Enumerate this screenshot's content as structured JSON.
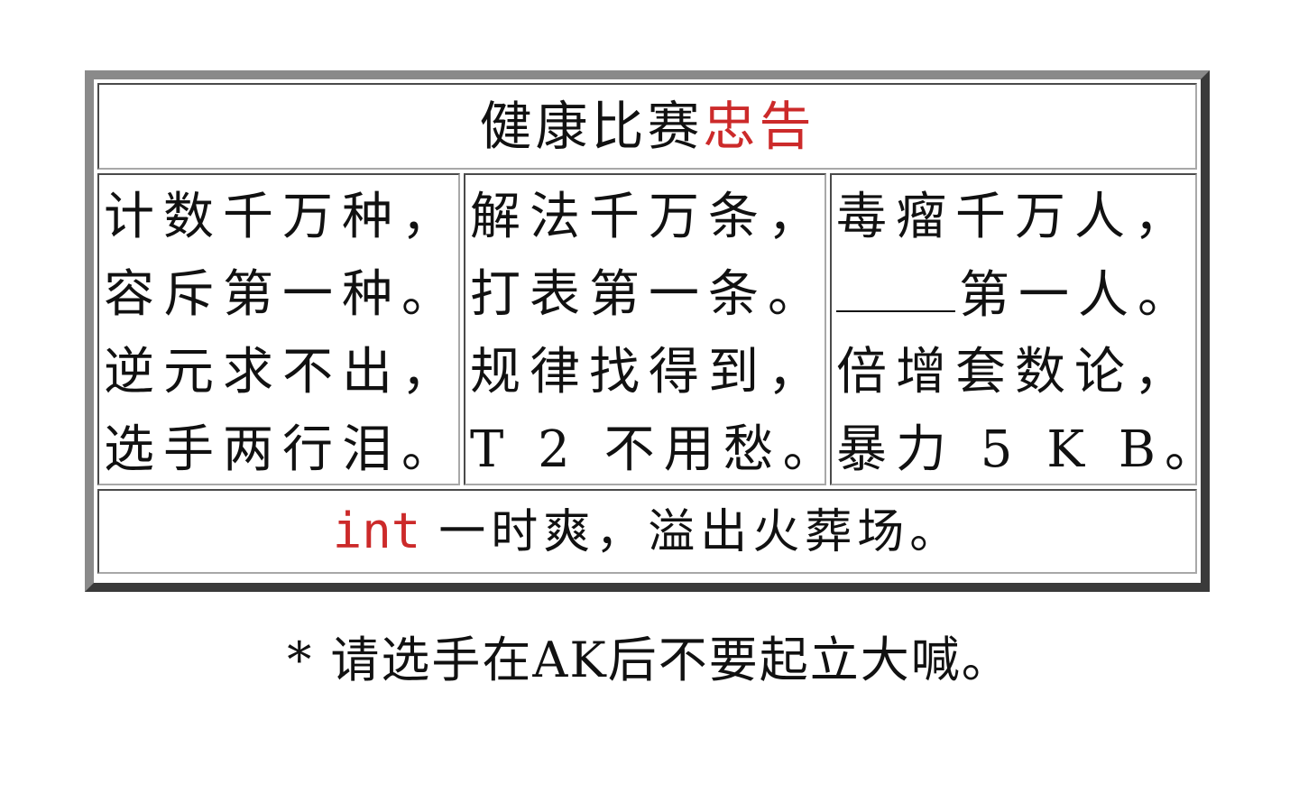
{
  "title": {
    "main": "健康比赛",
    "accent": "忠告"
  },
  "verses": [
    {
      "lines": [
        "计数千万种，",
        "容斥第一种。",
        "逆元求不出，",
        "选手两行泪。"
      ]
    },
    {
      "lines": [
        "解法千万条，",
        "打表第一条。",
        "规律找得到，",
        "T 2 不用愁。"
      ]
    },
    {
      "lines": [
        "毒瘤千万人，",
        "第一人。",
        "倍增套数论，",
        "暴力 5 K B。"
      ]
    }
  ],
  "footer": {
    "code": "int",
    "text": "一时爽，溢出火葬场。"
  },
  "note": "* 请选手在AK后不要起立大喊。",
  "colors": {
    "accent": "#cc2a2a",
    "text": "#111111",
    "frame": "#5a5a5a"
  }
}
